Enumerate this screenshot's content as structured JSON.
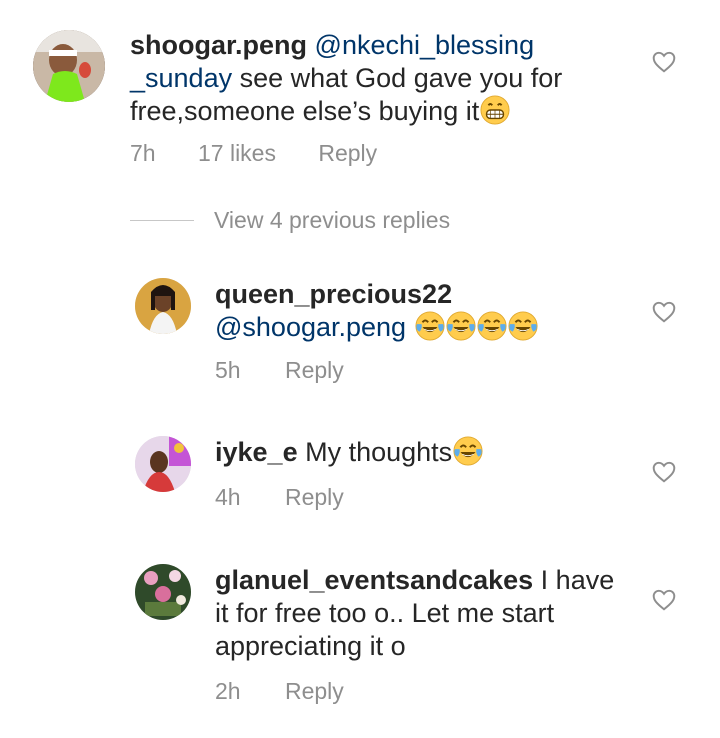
{
  "comments": [
    {
      "username": "shoogar.peng",
      "mention": "@nkechi_blessing",
      "mention_cont": "_sunday",
      "text_line1_rest": " see what God gave you for",
      "text_line2": "free,someone else’s buying it",
      "emoji": "grinning-face-emoji",
      "time": "7h",
      "likes": "17 likes",
      "reply": "Reply"
    },
    {
      "username": "queen_precious22",
      "mention": "@shoogar.peng",
      "emoji": "tears-of-joy-emoji",
      "emoji_count": 4,
      "time": "5h",
      "reply": "Reply"
    },
    {
      "username": "iyke_e",
      "text": " My thoughts",
      "emoji": "tears-of-joy-emoji",
      "time": "4h",
      "reply": "Reply"
    },
    {
      "username": "glanuel_eventsandcakes",
      "text_line1_rest": " I have",
      "text_line2": "it for free too o.. Let me start",
      "text_line3": "appreciating it o",
      "time": "2h",
      "reply": "Reply"
    }
  ],
  "view_previous_replies": "View 4 previous replies",
  "colors": {
    "text": "#262626",
    "mention": "#003569",
    "muted": "#8e8e8e",
    "divider": "#c7c7c7"
  }
}
